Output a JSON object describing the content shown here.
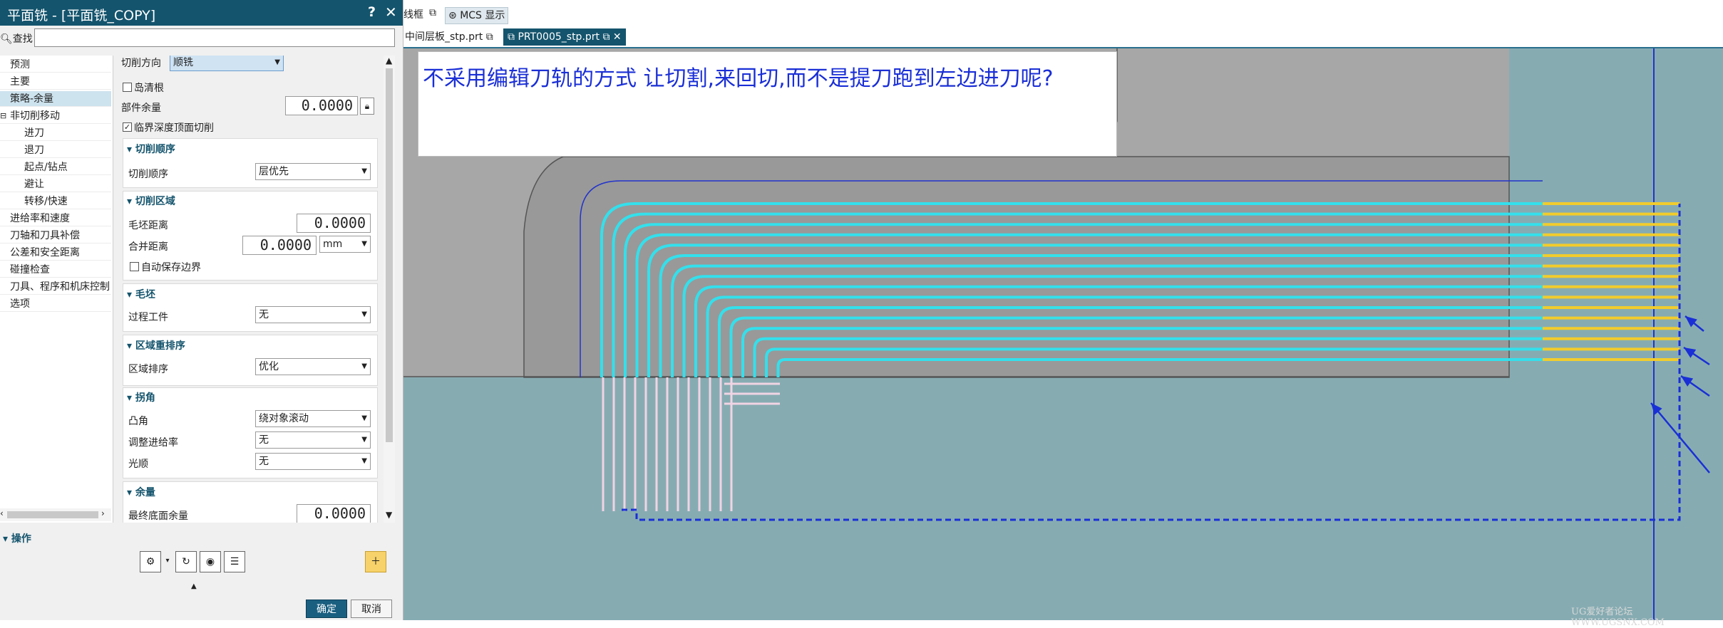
{
  "dialog": {
    "title": "平面铣 - [平面铣_COPY]",
    "help": "?",
    "close": "✕",
    "find_label": "查找",
    "find_value": ""
  },
  "tree": [
    {
      "label": "预测",
      "indent": 1,
      "selected": false
    },
    {
      "label": "主要",
      "indent": 1,
      "selected": false
    },
    {
      "label": "策略-余量",
      "indent": 1,
      "selected": true
    },
    {
      "label": "非切削移动",
      "indent": 1,
      "selected": false,
      "expander": "⊟"
    },
    {
      "label": "进刀",
      "indent": 2,
      "selected": false
    },
    {
      "label": "退刀",
      "indent": 2,
      "selected": false
    },
    {
      "label": "起点/钻点",
      "indent": 2,
      "selected": false
    },
    {
      "label": "避让",
      "indent": 2,
      "selected": false
    },
    {
      "label": "转移/快速",
      "indent": 2,
      "selected": false
    },
    {
      "label": "进给率和速度",
      "indent": 1,
      "selected": false
    },
    {
      "label": "刀轴和刀具补偿",
      "indent": 1,
      "selected": false
    },
    {
      "label": "公差和安全距离",
      "indent": 1,
      "selected": false
    },
    {
      "label": "碰撞检查",
      "indent": 1,
      "selected": false
    },
    {
      "label": "刀具、程序和机床控制",
      "indent": 1,
      "selected": false
    },
    {
      "label": "选项",
      "indent": 1,
      "selected": false
    }
  ],
  "form": {
    "cut_direction_label": "切削方向",
    "cut_direction_value": "顺铣",
    "island_cleanup_label": "岛清根",
    "island_cleanup_checked": false,
    "part_stock_label": "部件余量",
    "part_stock_value": "0.0000",
    "critical_depth_label": "临界深度顶面切削",
    "critical_depth_checked": true,
    "cut_order_group": "切削顺序",
    "cut_order_label": "切削顺序",
    "cut_order_value": "层优先",
    "cut_region_group": "切削区域",
    "blank_distance_label": "毛坯距离",
    "blank_distance_value": "0.0000",
    "merge_distance_label": "合并距离",
    "merge_distance_value": "0.0000",
    "merge_distance_unit": "mm",
    "auto_save_boundary_label": "自动保存边界",
    "auto_save_boundary_checked": false,
    "blank_group": "毛坯",
    "ipw_label": "过程工件",
    "ipw_value": "无",
    "region_sequencing_group": "区域重排序",
    "region_sequencing_label": "区域排序",
    "region_sequencing_value": "优化",
    "corner_group": "拐角",
    "convex_corner_label": "凸角",
    "convex_corner_value": "绕对象滚动",
    "adjust_feed_label": "调整进给率",
    "adjust_feed_value": "无",
    "smoothing_label": "光顺",
    "smoothing_value": "无",
    "stock_group": "余量",
    "final_floor_stock_label": "最终底面余量",
    "final_floor_stock_value": "0.0000"
  },
  "actions": {
    "header": "操作",
    "ok": "确定",
    "cancel": "取消"
  },
  "toolbar": {
    "wireframe_label": "线框",
    "mcs_label": "MCS 显示"
  },
  "tabs": [
    {
      "label": "中间层板_stp.prt ⧉",
      "active": false
    },
    {
      "label": "⧉ PRT0005_stp.prt ⧉ ✕",
      "active": true
    }
  ],
  "annotation": {
    "text": "不采用编辑刀轨的方式 让切割,来回切,而不是提刀跑到左边进刀呢?"
  },
  "watermark": "UG爱好者论坛 WWW.UGSNX.COM",
  "colors": {
    "titlebar": "#14546d",
    "viewport_bg": "#86acb2",
    "part_gray": "#9a9a9a",
    "cyan_path": "#33e0ec",
    "yellow_path": "#f2cc2c",
    "blue_annotation": "#1a2fd6",
    "pink_path": "#f0d4e4"
  }
}
